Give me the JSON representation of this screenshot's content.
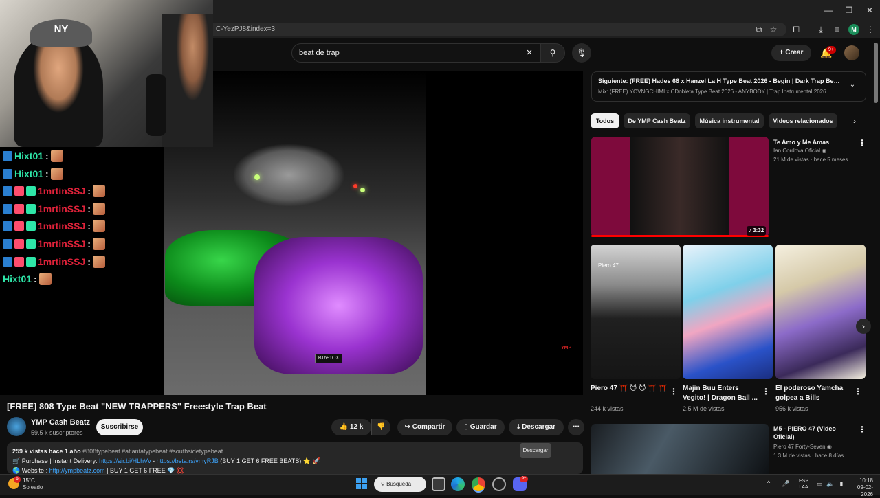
{
  "browser": {
    "url_fragment": "C-YezPJ8&index=3",
    "profile_initial": "M"
  },
  "header": {
    "search_value": "beat de trap",
    "create_label": "Crear",
    "notif_count": "9+"
  },
  "overlay": {
    "chat": [
      {
        "user": "Hixt01",
        "color": "#2ee6a8"
      },
      {
        "user": "Hixt01",
        "color": "#2ee6a8"
      },
      {
        "user": "1mrtinSSJ",
        "color": "#e0223a"
      },
      {
        "user": "1mrtinSSJ",
        "color": "#e0223a"
      },
      {
        "user": "1mrtinSSJ",
        "color": "#e0223a"
      },
      {
        "user": "1mrtinSSJ",
        "color": "#e0223a"
      },
      {
        "user": "1mrtinSSJ",
        "color": "#e0223a"
      },
      {
        "user": "Hixt01",
        "color": "#2ee6a8"
      }
    ],
    "colon": ":",
    "cap_logo": "NY"
  },
  "video": {
    "plate_text": "B1691OX",
    "watermark": "YMP",
    "title": "[FREE] 808 Type Beat \"NEW TRAPPERS\" Freestyle Trap Beat",
    "channel": "YMP Cash Beatz",
    "subscribers": "59.5 k suscriptores",
    "subscribe_label": "Suscribirse",
    "likes": "12 k",
    "share_label": "Compartir",
    "save_label": "Guardar",
    "download_label": "Descargar",
    "tooltip": "Descargar",
    "desc_stats": "259 k vistas  hace 1 año",
    "desc_tags": "#808typebeat #atlantatypebeat #southsidetypebeat",
    "desc_purchase": "Purchase | Instant Delivery:",
    "desc_link1": "https://air.bi/HLhVv",
    "desc_sep": " - ",
    "desc_link2": "https://bsta.rs/vmyRJB",
    "desc_offer": "(BUY 1 GET 6 FREE BEATS)",
    "desc_website": "Website :",
    "desc_link3": "http://ympbeatz.com",
    "desc_offer2": "| BUY 1 GET 6 FREE"
  },
  "sidebar": {
    "next_title": "Siguiente: (FREE) Hades 66 x Hanzel La H Type Beat 2026 - Begin | Dark Trap Beat ...",
    "next_sub": "Mix: (FREE) YOVNGCHIMI x CDobleta Type Beat 2026 - ANYBODY | Trap Instrumental 2026",
    "chips": [
      "Todos",
      "De YMP Cash Beatz",
      "Música instrumental",
      "Videos relacionados"
    ],
    "rec1": {
      "title": "Te Amo y Me Amas",
      "channel": "Ian Cordova Oficial",
      "meta": "21 M de vistas · hace 5 meses",
      "duration": "3:32"
    },
    "shorts": [
      {
        "title": "Piero 47 ⛩️ 😈 😈 ⛩️ ⛩️",
        "views": "244 k vistas",
        "overlay": "Piero 47"
      },
      {
        "title": "Majin Buu Enters Vegito! | Dragon Ball ...",
        "views": "2.5 M de vistas"
      },
      {
        "title": "El poderoso Yamcha golpea a Bills",
        "views": "956 k vistas"
      }
    ],
    "rec2": {
      "title": "M5 - PIERO 47 (Video Oficial)",
      "channel": "Piero 47 Forty-Seven",
      "meta": "1.3 M de vistas · hace 8 días"
    }
  },
  "taskbar": {
    "temp": "15°C",
    "weather": "Soleado",
    "weather_badge": "6",
    "search_label": "Búsqueda",
    "discord_badge": "9+",
    "lang_top": "ESP",
    "lang_bottom": "LAA",
    "time": "10:18",
    "date": "09-02-2026"
  },
  "colors": {
    "accent_red": "#ff0000",
    "link_blue": "#3ea6ff",
    "chat_green": "#2ee6a8",
    "chat_red": "#e0223a"
  }
}
